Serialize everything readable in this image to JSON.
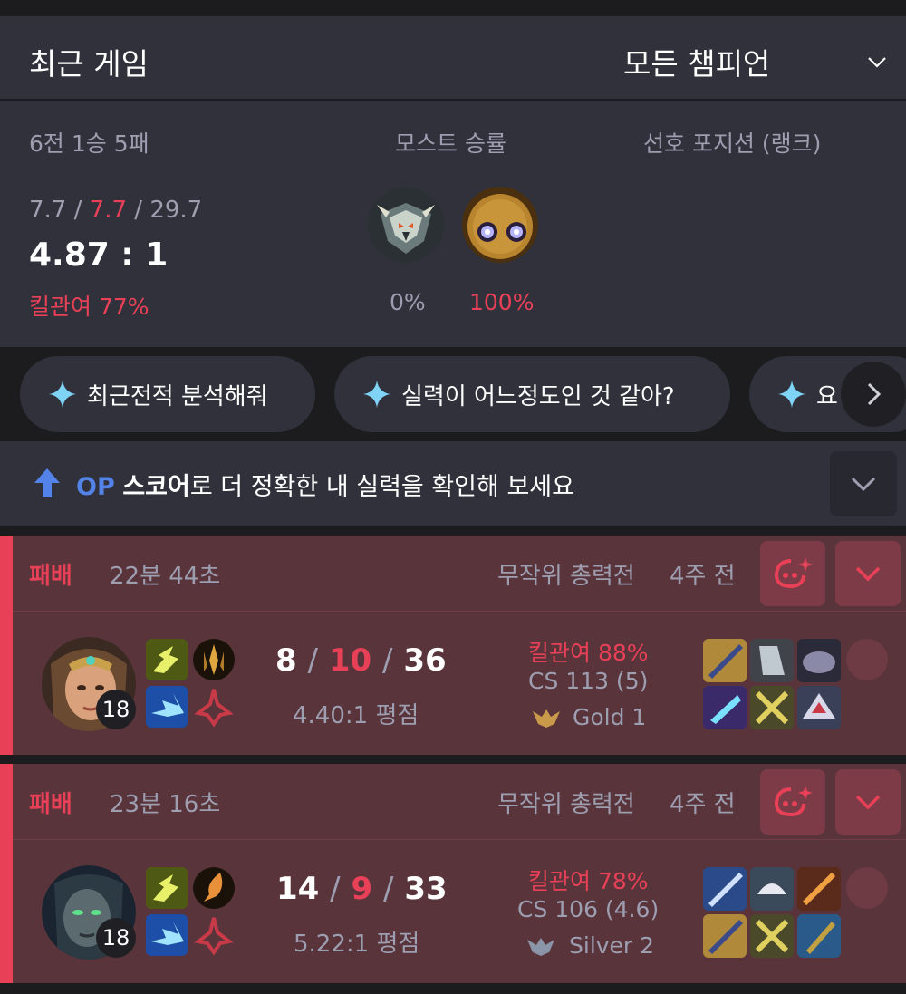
{
  "header": {
    "title": "최근 게임",
    "filter": "모든 챔피언"
  },
  "summary": {
    "record": "6전 1승 5패",
    "kills": "7.7",
    "deaths": "7.7",
    "assists": "29.7",
    "kda_sep": "/",
    "ratio": "4.87 : 1",
    "kill_participation": "킬관여 77%",
    "most_label": "모스트 승률",
    "position_label": "선호 포지션 (랭크)",
    "most_winrates": [
      "0%",
      "100%"
    ]
  },
  "chips": [
    {
      "label": "최근전적 분석해줘"
    },
    {
      "label": "실력이 어느정도인 것 같아?"
    },
    {
      "label": "요"
    }
  ],
  "op_banner": {
    "op": "OP",
    "score": "스코어",
    "rest": "로 더 정확한 내 실력을 확인해 보세요"
  },
  "matches": [
    {
      "result": "패배",
      "duration": "22분 44초",
      "mode": "무작위 총력전",
      "ago": "4주 전",
      "level": "18",
      "kills": "8",
      "deaths": "10",
      "assists": "36",
      "kda_ratio": "4.40:1 평점",
      "kill_participation": "킬관여 88%",
      "cs": "CS 113 (5)",
      "tier": "Gold 1"
    },
    {
      "result": "패배",
      "duration": "23분 16초",
      "mode": "무작위 총력전",
      "ago": "4주 전",
      "level": "18",
      "kills": "14",
      "deaths": "9",
      "assists": "33",
      "kda_ratio": "5.22:1 평점",
      "kill_participation": "킬관여 78%",
      "cs": "CS 106 (4.6)",
      "tier": "Silver 2"
    }
  ],
  "colors": {
    "loss": "#e84057",
    "accent": "#5383e8",
    "card_bg": "#59343b",
    "panel": "#31313c"
  }
}
